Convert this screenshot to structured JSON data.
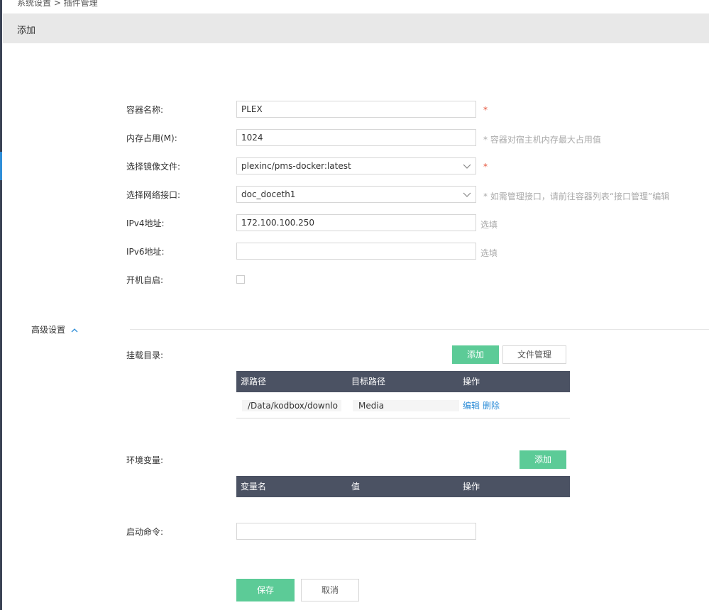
{
  "breadcrumb": "系统设置 > 插件管理",
  "header": {
    "title": "添加"
  },
  "form": {
    "container_name": {
      "label": "容器名称:",
      "value": "PLEX",
      "required": "*"
    },
    "memory": {
      "label": "内存占用(M):",
      "value": "1024",
      "hint": "* 容器对宿主机内存最大占用值"
    },
    "image": {
      "label": "选择镜像文件:",
      "value": "plexinc/pms-docker:latest",
      "required": "*"
    },
    "network": {
      "label": "选择网络接口:",
      "value": "doc_doceth1",
      "hint": "* 如需管理接口，请前往容器列表“接口管理”编辑"
    },
    "ipv4": {
      "label": "IPv4地址:",
      "value": "172.100.100.250",
      "optional": "选填"
    },
    "ipv6": {
      "label": "IPv6地址:",
      "value": "",
      "optional": "选填"
    },
    "autostart": {
      "label": "开机自启:"
    }
  },
  "advanced": {
    "title": "高级设置",
    "mounts": {
      "label": "挂载目录:",
      "add_label": "添加",
      "file_manager_label": "文件管理",
      "columns": [
        "源路径",
        "目标路径",
        "操作"
      ],
      "rows": [
        {
          "source": "/Data/kodbox/downlo",
          "target": "Media",
          "edit": "编辑",
          "delete": "删除"
        }
      ]
    },
    "env": {
      "label": "环境变量:",
      "add_label": "添加",
      "columns": [
        "变量名",
        "值",
        "操作"
      ]
    },
    "command": {
      "label": "启动命令:",
      "value": ""
    }
  },
  "actions": {
    "save": "保存",
    "cancel": "取消"
  },
  "colors": {
    "accent_green": "#5ccb97",
    "table_header": "#4b5263",
    "link": "#2f8ed8",
    "required": "#e5533a"
  }
}
